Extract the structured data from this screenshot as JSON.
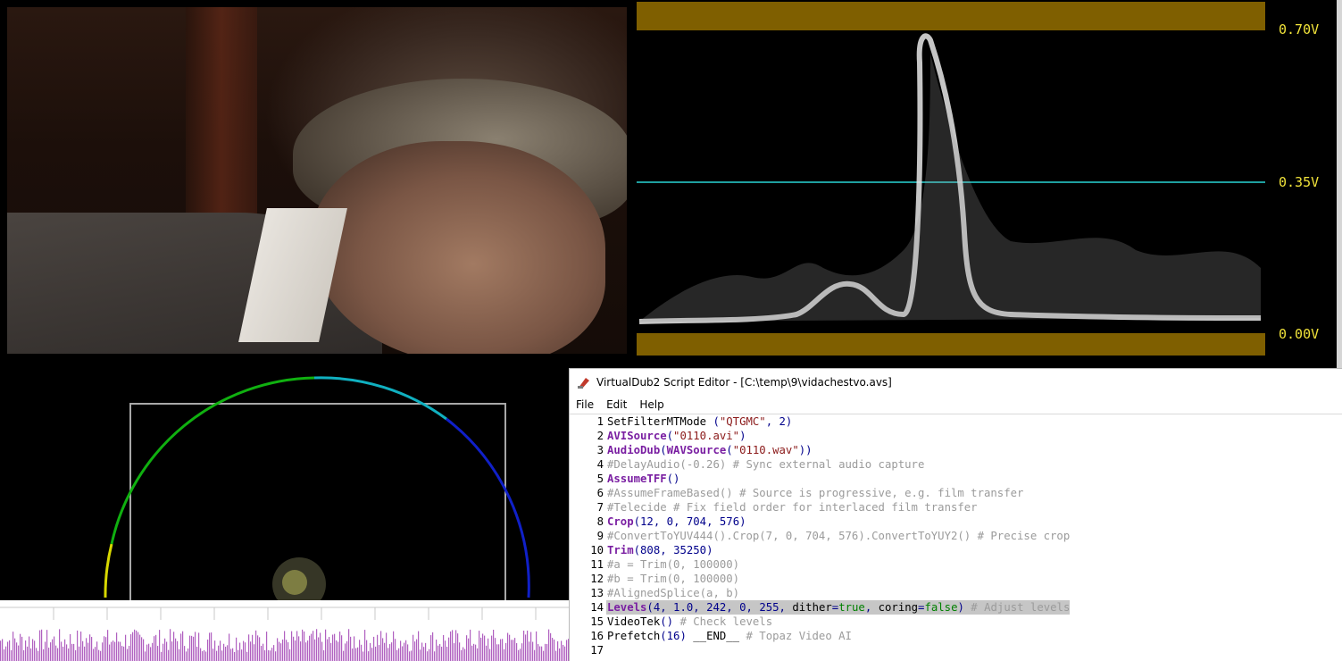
{
  "waveform": {
    "labels": [
      "0.70V",
      "0.35V",
      "0.00V"
    ],
    "colors": {
      "limit_band": "#7f5f00",
      "mid_line": "#1fa0a0",
      "label": "#f1e33a",
      "trace": "#e8e8e8"
    }
  },
  "vectorscope": {
    "colors": {
      "outline": "#a8a8a8"
    }
  },
  "audio": {
    "colors": {
      "wave": "#b060c0"
    }
  },
  "editor": {
    "icon": "virtualdub-icon",
    "title": "VirtualDub2 Script Editor - [C:\\temp\\9\\vidachestvo.avs]",
    "menu": [
      "File",
      "Edit",
      "Help"
    ],
    "lines": [
      {
        "num": "1",
        "segments": [
          [
            "fn",
            "SetFilterMTMode"
          ],
          [
            "punc",
            " ("
          ],
          [
            "str",
            "\"QTGMC\""
          ],
          [
            "punc",
            ", "
          ],
          [
            "num2",
            "2"
          ],
          [
            "punc",
            ")"
          ]
        ]
      },
      {
        "num": "2",
        "segments": [
          [
            "kw",
            "AVISource"
          ],
          [
            "punc",
            "("
          ],
          [
            "str",
            "\"0110.avi\""
          ],
          [
            "punc",
            ")"
          ]
        ]
      },
      {
        "num": "3",
        "segments": [
          [
            "kw",
            "AudioDub"
          ],
          [
            "punc",
            "("
          ],
          [
            "kw",
            "WAVSource"
          ],
          [
            "punc",
            "("
          ],
          [
            "str",
            "\"0110.wav\""
          ],
          [
            "punc",
            "))"
          ]
        ]
      },
      {
        "num": "4",
        "segments": [
          [
            "cmt",
            "#DelayAudio(-0.26) # Sync external audio capture"
          ]
        ]
      },
      {
        "num": "5",
        "segments": [
          [
            "kw",
            "AssumeTFF"
          ],
          [
            "punc",
            "()"
          ]
        ]
      },
      {
        "num": "6",
        "segments": [
          [
            "cmt",
            "#AssumeFrameBased() # Source is progressive, e.g. film transfer"
          ]
        ]
      },
      {
        "num": "7",
        "segments": [
          [
            "cmt",
            "#Telecide # Fix field order for interlaced film transfer"
          ]
        ]
      },
      {
        "num": "8",
        "segments": [
          [
            "kw",
            "Crop"
          ],
          [
            "punc",
            "("
          ],
          [
            "num2",
            "12"
          ],
          [
            "punc",
            ", "
          ],
          [
            "num2",
            "0"
          ],
          [
            "punc",
            ", "
          ],
          [
            "num2",
            "704"
          ],
          [
            "punc",
            ", "
          ],
          [
            "num2",
            "576"
          ],
          [
            "punc",
            ")"
          ]
        ]
      },
      {
        "num": "9",
        "segments": [
          [
            "cmt",
            "#ConvertToYUV444().Crop(7, 0, 704, 576).ConvertToYUY2() # Precise crop"
          ]
        ]
      },
      {
        "num": "10",
        "segments": [
          [
            "kw",
            "Trim"
          ],
          [
            "punc",
            "("
          ],
          [
            "num2",
            "808"
          ],
          [
            "punc",
            ", "
          ],
          [
            "num2",
            "35250"
          ],
          [
            "punc",
            ")"
          ]
        ]
      },
      {
        "num": "11",
        "segments": [
          [
            "cmt",
            "#a = Trim(0, 100000)"
          ]
        ]
      },
      {
        "num": "12",
        "segments": [
          [
            "cmt",
            "#b = Trim(0, 100000)"
          ]
        ]
      },
      {
        "num": "13",
        "segments": [
          [
            "cmt",
            "#AlignedSplice(a, b)"
          ]
        ]
      },
      {
        "num": "14",
        "selected": true,
        "segments": [
          [
            "kw",
            "Levels"
          ],
          [
            "punc",
            "("
          ],
          [
            "num2",
            "4"
          ],
          [
            "punc",
            ", "
          ],
          [
            "num2",
            "1.0"
          ],
          [
            "punc",
            ", "
          ],
          [
            "num2",
            "242"
          ],
          [
            "punc",
            ", "
          ],
          [
            "num2",
            "0"
          ],
          [
            "punc",
            ", "
          ],
          [
            "num2",
            "255"
          ],
          [
            "punc",
            ", "
          ],
          [
            "fn",
            "dither"
          ],
          [
            "punc",
            "="
          ],
          [
            "bool",
            "true"
          ],
          [
            "punc",
            ", "
          ],
          [
            "fn",
            "coring"
          ],
          [
            "punc",
            "="
          ],
          [
            "bool",
            "false"
          ],
          [
            "punc",
            ") "
          ],
          [
            "cmt",
            "# Adjust levels"
          ]
        ]
      },
      {
        "num": "15",
        "segments": [
          [
            "fn",
            "VideoTek"
          ],
          [
            "punc",
            "() "
          ],
          [
            "cmt",
            "# Check levels"
          ]
        ]
      },
      {
        "num": "16",
        "segments": [
          [
            "fn",
            "Prefetch"
          ],
          [
            "punc",
            "("
          ],
          [
            "num2",
            "16"
          ],
          [
            "punc",
            ") "
          ],
          [
            "fn",
            "__END__"
          ],
          [
            "punc",
            " "
          ],
          [
            "cmt",
            "# Topaz Video AI"
          ]
        ]
      },
      {
        "num": "17",
        "segments": []
      }
    ]
  }
}
